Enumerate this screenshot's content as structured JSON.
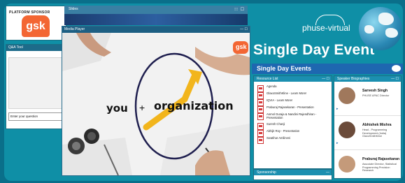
{
  "sponsor": {
    "label": "PLATFORM SPONSOR",
    "logo_text": "gsk",
    "brand_color": "#f36633"
  },
  "qa": {
    "title": "Q&A Tool",
    "input_placeholder": "Enter your question"
  },
  "slides_panel": {
    "title": "Slides",
    "controls": "⁝⁝ ☐"
  },
  "media_player": {
    "title": "Media Player",
    "controls": "— ☐",
    "slide": {
      "word_left": "you",
      "plus": "+",
      "word_right": "organization",
      "logo_text": "gsk"
    }
  },
  "event": {
    "brand": "phuse-virtual",
    "title": "Single Day Event"
  },
  "events_bar": {
    "title": "Single Day Events",
    "logo_icon": "phuse-logo-icon"
  },
  "resources": {
    "title": "Resource List",
    "controls": "— ☐",
    "items": [
      "Agenda",
      "GlaxoSmithKline - Learn More!",
      "IQVIA - Learn More!",
      "Praburaj Rajasekaran - Presentation",
      "Anmol Guraja & Nandini Rajendhiran - Presentation",
      "Suresh Chanji",
      "Abhijit Roy - Presentation",
      "Swatihar Amilineni"
    ]
  },
  "speakers": {
    "title": "Speaker Biographies",
    "controls": "— ☐",
    "list": [
      {
        "name": "Sarvesh Singh",
        "role": "PHUSE APAC Director"
      },
      {
        "name": "Abhishek Mishra",
        "role": "Head - Programming Development (India) GlaxoSmithKline"
      },
      {
        "name": "Praburaj Rajasekaran",
        "role": "Associate Director, Statistical Programming Precision Research"
      }
    ]
  },
  "sponsorship": {
    "title": "Sponsorship",
    "controls": "—"
  }
}
